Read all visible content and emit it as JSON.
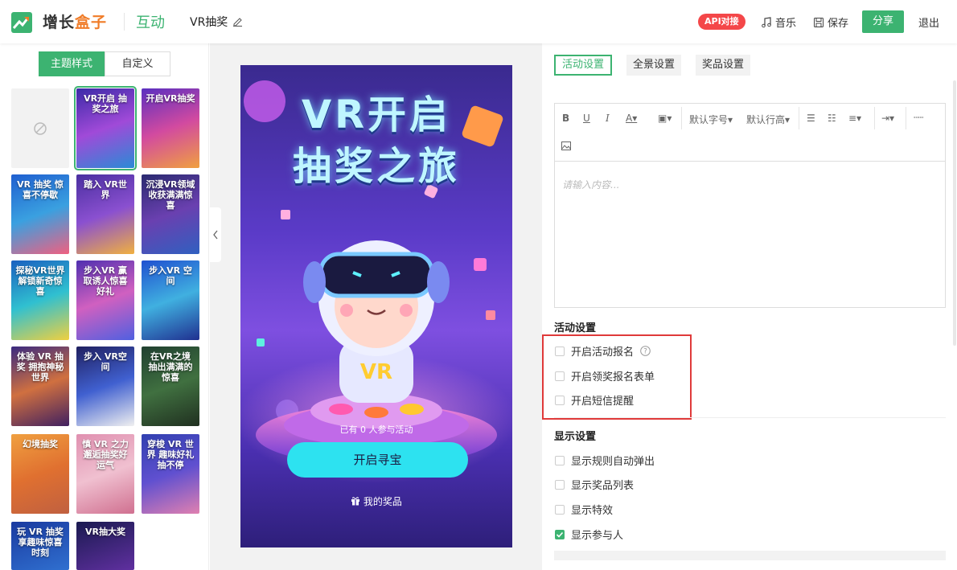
{
  "header": {
    "brand_part1": "增长",
    "brand_part2": "盒子",
    "module": "互动",
    "project_title": "VR抽奖",
    "api_badge": "API对接",
    "music": "音乐",
    "save": "保存",
    "share": "分享",
    "logout": "退出"
  },
  "left": {
    "tabs": [
      "主题样式",
      "自定义"
    ],
    "thumbnails": [
      {
        "text": ""
      },
      {
        "text": "VR开启 抽奖之旅"
      },
      {
        "text": "开启VR抽奖"
      },
      {
        "text": "VR 抽奖 惊喜不停歇"
      },
      {
        "text": "踏入 VR世界"
      },
      {
        "text": "沉浸VR领域 收获满满惊喜"
      },
      {
        "text": "探秘VR世界 解锁新奇惊喜"
      },
      {
        "text": "步入VR 赢取诱人惊喜好礼"
      },
      {
        "text": "步入VR 空间"
      },
      {
        "text": "体验 VR 抽奖 拥抱神秘世界"
      },
      {
        "text": "步入 VR空间"
      },
      {
        "text": "在VR之境 抽出满满的惊喜"
      },
      {
        "text": "幻境抽奖"
      },
      {
        "text": "慎 VR 之力 邂逅抽奖好运气"
      },
      {
        "text": "穿梭 VR 世界 趣味好礼抽不停"
      },
      {
        "text": "玩 VR 抽奖 享趣味惊喜时刻"
      },
      {
        "text": "VR抽大奖"
      }
    ]
  },
  "preview": {
    "title_line1": "VR开启",
    "title_line2": "抽奖之旅",
    "participants": "已有 0 人参与活动",
    "start_button": "开启寻宝",
    "my_prizes": "我的奖品"
  },
  "right": {
    "tabs": [
      "活动设置",
      "全景设置",
      "奖品设置"
    ],
    "toolbar": {
      "font_size": "默认字号",
      "line_height": "默认行高"
    },
    "editor_placeholder": "请输入内容...",
    "activity_section": "活动设置",
    "activity_options": [
      {
        "label": "开启活动报名",
        "checked": false
      },
      {
        "label": "开启领奖报名表单",
        "checked": false
      },
      {
        "label": "开启短信提醒",
        "checked": false
      }
    ],
    "display_section": "显示设置",
    "display_options": [
      {
        "label": "显示规则自动弹出",
        "checked": false
      },
      {
        "label": "显示奖品列表",
        "checked": false
      },
      {
        "label": "显示特效",
        "checked": false
      },
      {
        "label": "显示参与人",
        "checked": true
      }
    ]
  },
  "colors": {
    "accent": "#3cb371",
    "brand_orange": "#f07c28",
    "api_red": "#f44749",
    "highlight_red": "#e03a3a",
    "cta_cyan": "#2de2f0"
  }
}
